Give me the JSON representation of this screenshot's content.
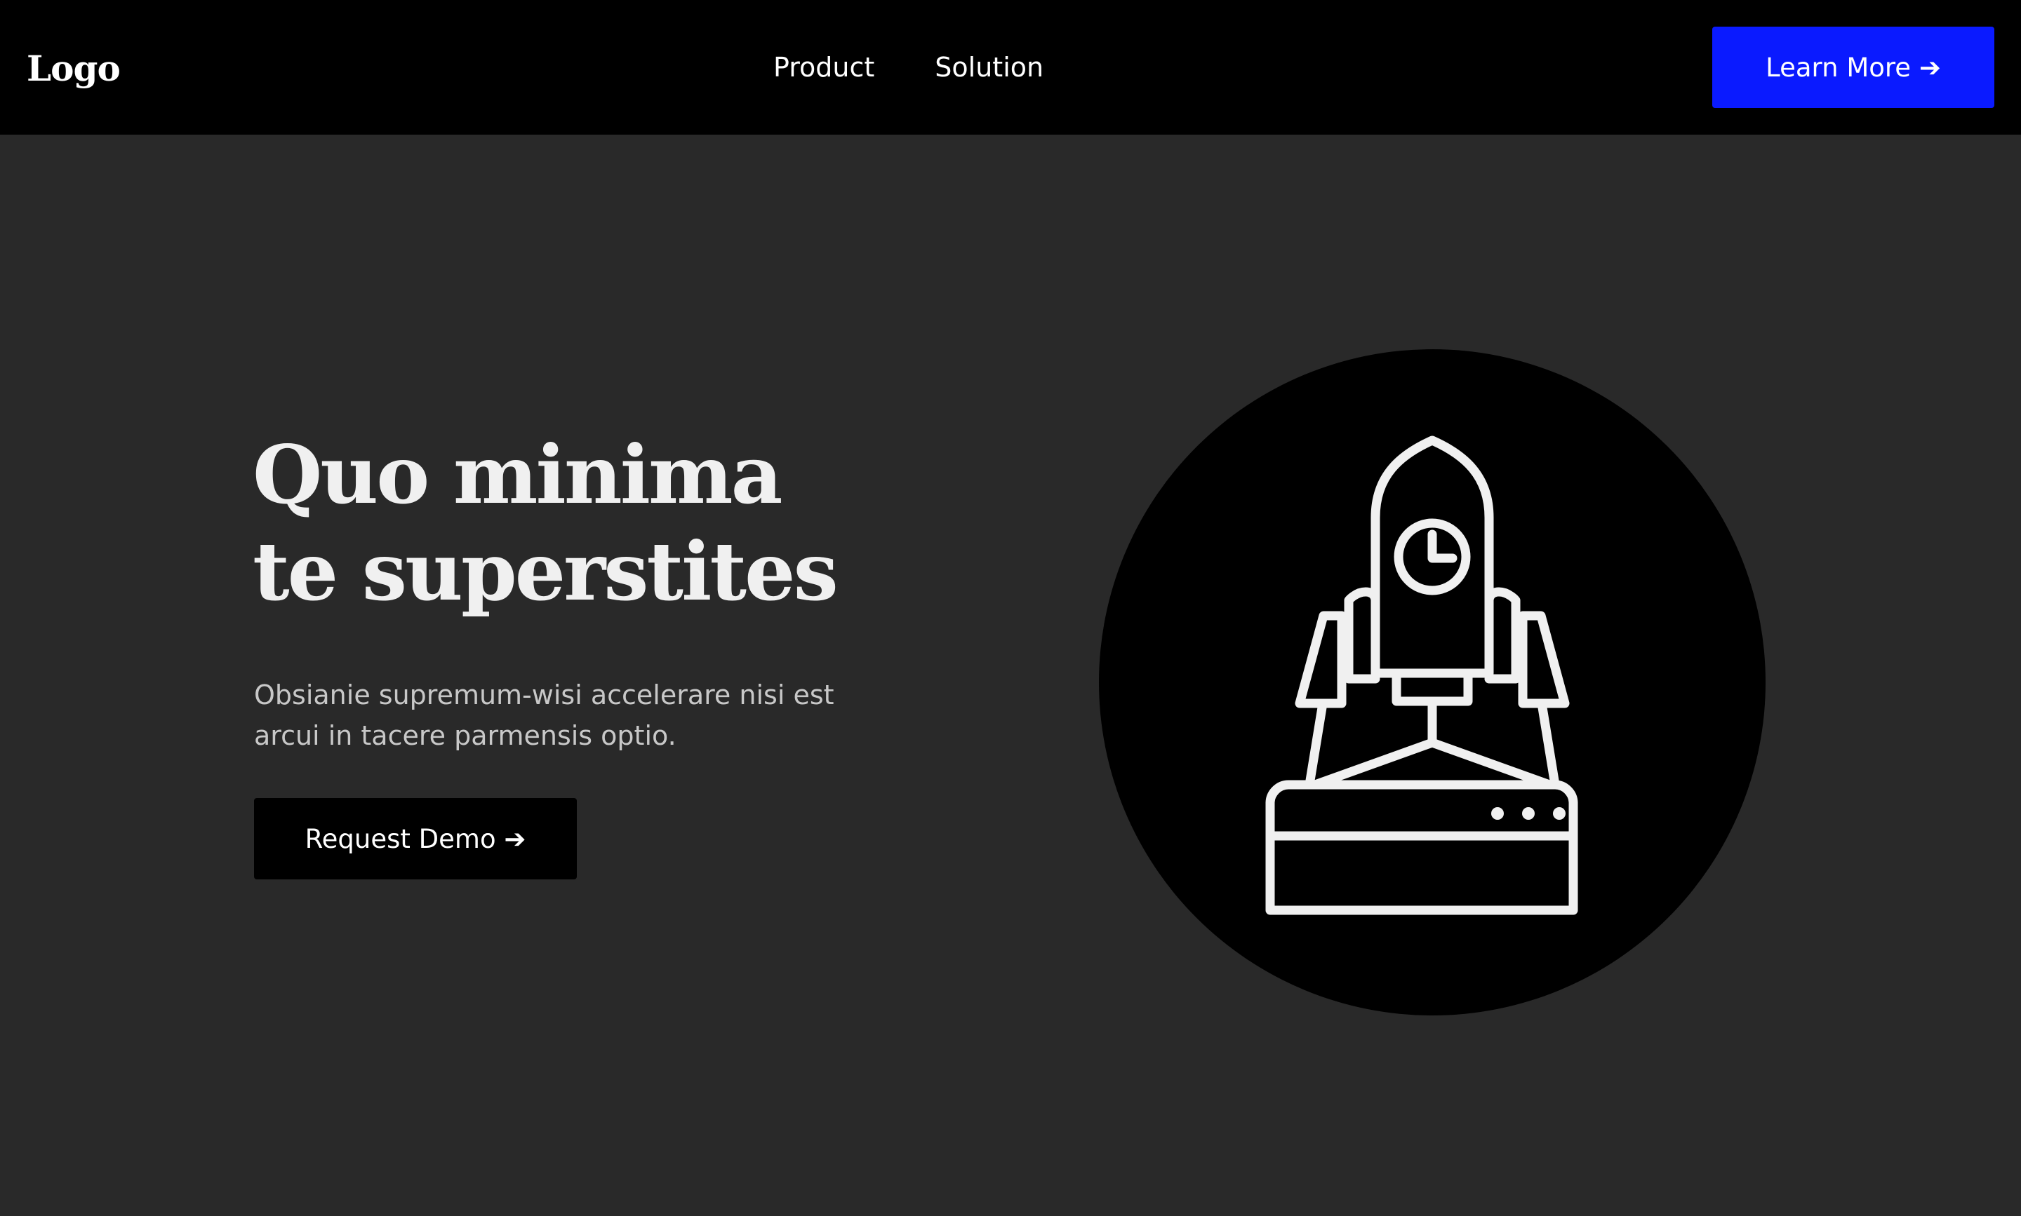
{
  "header": {
    "logo": "Logo",
    "nav": [
      {
        "label": "Product"
      },
      {
        "label": "Solution"
      }
    ],
    "cta_label": "Learn More ➔"
  },
  "hero": {
    "title": "Quo minima te superstites",
    "subtitle": "Obsianie supremum-wisi accelerare nisi est arcui in tacere parmensis optio.",
    "cta_label": "Request Demo ➔",
    "illustration_icon": "rocket-launch-icon"
  },
  "colors": {
    "nav_background": "#000000",
    "page_background": "#292929",
    "accent": "#0a1aff",
    "text": "#ffffff",
    "icon_stroke": "#f0f0f0"
  }
}
